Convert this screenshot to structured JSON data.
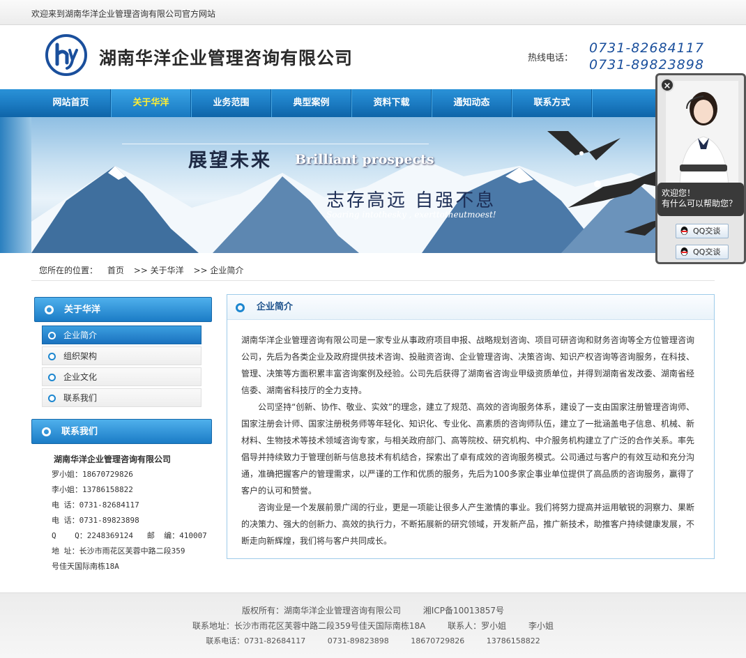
{
  "topbar": {
    "welcome": "欢迎来到湖南华洋企业管理咨询有限公司官方网站"
  },
  "header": {
    "company_name": "湖南华洋企业管理咨询有限公司",
    "hotline_label": "热线电话：",
    "phones": [
      "0731-82684117",
      "0731-89823898"
    ]
  },
  "nav": {
    "items": [
      {
        "label": "网站首页"
      },
      {
        "label": "关于华洋"
      },
      {
        "label": "业务范围"
      },
      {
        "label": "典型案例"
      },
      {
        "label": "资料下载"
      },
      {
        "label": "通知动态"
      },
      {
        "label": "联系方式"
      }
    ],
    "active_index": 1
  },
  "banner": {
    "title_cn": "展望未来",
    "title_en": "Brilliant prospects",
    "slogan_cn": "志存高远  自强不息",
    "slogan_en": "Soaring intothesky , exerttotheutmoest!"
  },
  "breadcrumb": {
    "prefix": "您所在的位置：",
    "items": [
      "首页",
      ">> 关于华洋",
      ">> 企业简介"
    ]
  },
  "sidebar": {
    "about_title": "关于华洋",
    "items": [
      {
        "label": "企业简介"
      },
      {
        "label": "组织架构"
      },
      {
        "label": "企业文化"
      },
      {
        "label": "联系我们"
      }
    ],
    "contact_title": "联系我们",
    "contact": {
      "name": "湖南华洋企业管理咨询有限公司",
      "lines": [
        "罗小姐：18670729826",
        "李小姐：13786158822",
        "电  话：0731-82684117",
        "电  话：0731-89823898",
        "Q    Q：2248369124   邮  编：410007",
        "地  址：长沙市雨花区芙蓉中路二段359",
        "号佳天国际南栋18A"
      ]
    }
  },
  "main": {
    "title": "企业简介",
    "paragraphs": [
      "湖南华洋企业管理咨询有限公司是一家专业从事政府项目申报、战略规划咨询、项目可研咨询和财务咨询等全方位管理咨询公司，先后为各类企业及政府提供技术咨询、投融资咨询、企业管理咨询、决策咨询、知识产权咨询等咨询服务，在科技、管理、决策等方面积累丰富咨询案例及经验。公司先后获得了湖南省咨询业甲级资质单位，并得到湖南省发改委、湖南省经信委、湖南省科技厅的全力支持。",
      "公司坚持“创新、协作、敬业、实效”的理念，建立了规范、高效的咨询服务体系，建设了一支由国家注册管理咨询师、国家注册会计师、国家注册税务师等年轻化、知识化、专业化、高素质的咨询师队伍，建立了一批涵盖电子信息、机械、新材料、生物技术等技术领域咨询专家，与相关政府部门、高等院校、研究机构、中介服务机构建立了广泛的合作关系。率先倡导并持续致力于管理创新与信息技术有机结合，探索出了卓有成效的咨询服务模式。公司通过与客户的有效互动和充分沟通，准确把握客户的管理需求，以严谨的工作和优质的服务，先后为100多家企事业单位提供了高品质的咨询服务，赢得了客户的认可和赞誉。",
      "咨询业是一个发展前景广阔的行业，更是一项能让很多人产生激情的事业。我们将努力提高并运用敏锐的洞察力、果断的决策力、强大的创新力、高效的执行力，不断拓展新的研究领域，开发新产品，推广新技术，助推客户持续健康发展，不断走向新辉煌，我们将与客户共同成长。"
    ]
  },
  "footer": {
    "copyright": "版权所有：湖南华洋企业管理咨询有限公司",
    "icp": "湘ICP备10013857号",
    "address": "联系地址：长沙市雨花区芙蓉中路二段359号佳天国际南栋18A",
    "contact_person": "联系人：罗小姐",
    "contact_person2": "李小姐",
    "phones_label": "联系电话：0731-82684117",
    "phone2": "0731-89823898",
    "phone3": "18670729826",
    "phone4": "13786158822"
  },
  "chat": {
    "close": "×",
    "greeting_line1": "欢迎您！",
    "greeting_line2": "有什么可以帮助您？",
    "qq_buttons": [
      "QQ交谈",
      "QQ交谈"
    ]
  }
}
